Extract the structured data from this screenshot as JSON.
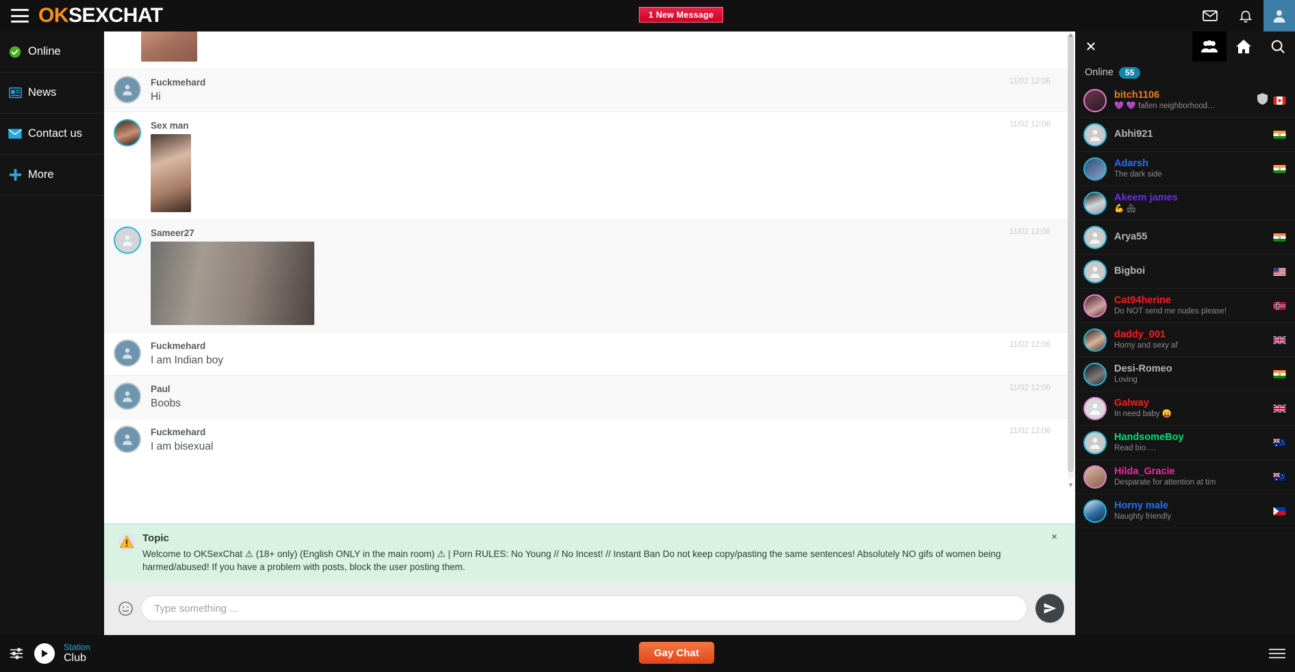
{
  "header": {
    "logo_ok": "OK",
    "logo_rest": "SEXCHAT",
    "new_message_badge": "1 New Message",
    "icons": [
      "menu-icon",
      "envelope-icon",
      "bell-icon",
      "user-avatar-icon"
    ]
  },
  "sidebar": {
    "items": [
      {
        "label": "Online",
        "icon": "check-circle-icon"
      },
      {
        "label": "News",
        "icon": "newspaper-icon"
      },
      {
        "label": "Contact us",
        "icon": "envelope-icon"
      },
      {
        "label": "More",
        "icon": "plus-icon"
      }
    ]
  },
  "chat": {
    "messages": [
      {
        "name": "",
        "text": "",
        "time": "",
        "image": "pic1",
        "partial": true
      },
      {
        "name": "Fuckmehard",
        "text": "Hi",
        "time": "11/02 12:06",
        "image": ""
      },
      {
        "name": "Sex man",
        "text": "",
        "time": "11/02 12:06",
        "image": "pic2"
      },
      {
        "name": "Sameer27",
        "text": "",
        "time": "11/02 12:06",
        "image": "pic3"
      },
      {
        "name": "Fuckmehard",
        "text": "I am Indian boy",
        "time": "11/02 12:06",
        "image": ""
      },
      {
        "name": "Paul",
        "text": "Boobs",
        "time": "11/02 12:06",
        "image": ""
      },
      {
        "name": "Fuckmehard",
        "text": "I am bisexual",
        "time": "11/02 12:06",
        "image": ""
      }
    ],
    "topic": {
      "title": "Topic",
      "text": "Welcome to OKSexChat ⚠ (18+ only) (English ONLY in the main room) ⚠ | Porn RULES: No Young // No Incest! // Instant Ban Do not keep copy/pasting the same sentences! Absolutely NO gifs of women being harmed/abused! If you have a problem with posts, block the user posting them.",
      "close_label": "×"
    },
    "composer": {
      "placeholder": "Type something ...",
      "value": "",
      "smiley_icon": "smiley-icon",
      "send_icon": "send-icon"
    }
  },
  "userlist": {
    "close_label": "✕",
    "tabs": [
      {
        "icon": "people-icon",
        "active": true
      },
      {
        "icon": "home-icon",
        "active": false
      },
      {
        "icon": "search-icon",
        "active": false
      }
    ],
    "online_label": "Online",
    "online_count": "55",
    "users": [
      {
        "name": "bitch1106",
        "status": "💜 💜 fallen neighborhood…",
        "color": "#e87e22",
        "ring": "pink",
        "flag": "ca",
        "shield": true
      },
      {
        "name": "Abhi921",
        "status": "",
        "color": "#b5b5b5",
        "ring": "blue",
        "flag": "in",
        "shield": false
      },
      {
        "name": "Adarsh",
        "status": "The dark side",
        "color": "#2a6df4",
        "ring": "blue",
        "flag": "in",
        "shield": false
      },
      {
        "name": "Akeem james",
        "status": "💪 🏘",
        "color": "#6a2af4",
        "ring": "blue",
        "flag": "",
        "shield": false
      },
      {
        "name": "Arya55",
        "status": "",
        "color": "#b5b5b5",
        "ring": "blue",
        "flag": "in",
        "shield": false
      },
      {
        "name": "Bigboi",
        "status": "",
        "color": "#b5b5b5",
        "ring": "blue",
        "flag": "us",
        "shield": false
      },
      {
        "name": "Cat94herine",
        "status": "Do NOT send me nudes please!",
        "color": "#f22020",
        "ring": "pink",
        "flag": "no",
        "shield": false
      },
      {
        "name": "daddy_001",
        "status": "Horny and sexy af",
        "color": "#f22020",
        "ring": "blue",
        "flag": "gb",
        "shield": false
      },
      {
        "name": "Desi-Romeo",
        "status": "Loving",
        "color": "#b5b5b5",
        "ring": "blue",
        "flag": "in",
        "shield": false
      },
      {
        "name": "Galway",
        "status": "In need baby 😛",
        "color": "#f22020",
        "ring": "pink",
        "flag": "gb",
        "shield": false
      },
      {
        "name": "HandsomeBoy",
        "status": "Read bio….",
        "color": "#00e07a",
        "ring": "blue",
        "flag": "au",
        "shield": false
      },
      {
        "name": "Hilda_Gracie",
        "status": "Desparate for attention at tim",
        "color": "#ef2aa0",
        "ring": "pink",
        "flag": "au",
        "shield": false
      },
      {
        "name": "Horny male",
        "status": "Naughty friendly",
        "color": "#2a6df4",
        "ring": "blue",
        "flag": "ph",
        "shield": false
      }
    ]
  },
  "footer": {
    "station_label": "Station",
    "station_name": "Club",
    "gay_chat_label": "Gay Chat",
    "equalizer_icon": "sliders-icon",
    "play_icon": "play-icon",
    "menu_icon": "menu-icon"
  }
}
